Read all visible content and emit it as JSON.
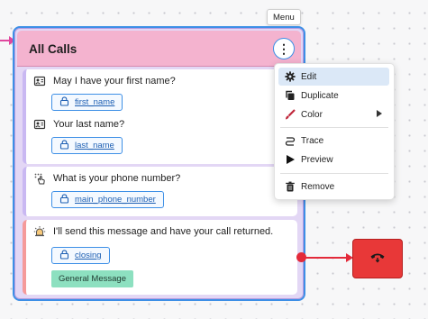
{
  "node": {
    "title": "All Calls",
    "menu_button": "⋮"
  },
  "steps": [
    {
      "text": "May I have your first name?",
      "icon": "contact-card-icon"
    },
    {
      "variable": "first_name",
      "icon": "variable-lock-icon"
    },
    {
      "text": "Your last name?",
      "icon": "contact-card-icon"
    },
    {
      "variable": "last_name",
      "icon": "variable-lock-icon"
    },
    {
      "text": "What is your phone number?",
      "icon": "dialpad-touch-icon"
    },
    {
      "variable": "main_phone_number",
      "icon": "variable-lock-icon"
    },
    {
      "text": "I'll send this message and have your call returned.",
      "icon": "alarm-bell-icon"
    },
    {
      "variable": "closing",
      "icon": "variable-lock-icon"
    },
    {
      "badge": "General Message"
    }
  ],
  "tooltip": "Menu",
  "menu": {
    "items": [
      {
        "label": "Edit",
        "icon": "gear-icon",
        "active": true
      },
      {
        "label": "Duplicate",
        "icon": "copy-icon"
      },
      {
        "label": "Color",
        "icon": "paint-brush-icon",
        "submenu": true
      },
      {
        "label": "Trace",
        "icon": "trace-icon"
      },
      {
        "label": "Preview",
        "icon": "play-icon"
      },
      {
        "label": "Remove",
        "icon": "trash-icon"
      }
    ]
  },
  "end_node": {
    "icon": "hang-up-phone-icon"
  },
  "colors": {
    "header": "#f4b3cf",
    "node_border": "#3d8fe6",
    "end_node": "#e83838",
    "badge": "#8de0c0",
    "incoming_edge": "#e0479e",
    "outgoing_edge": "#e32a3a"
  }
}
